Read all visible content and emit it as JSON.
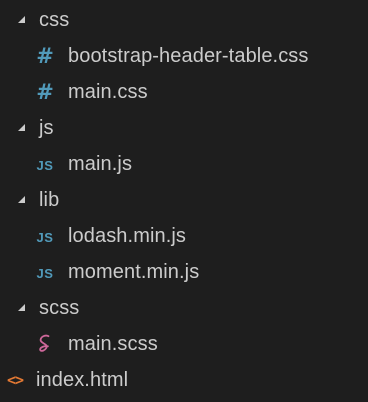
{
  "explorer": {
    "items": [
      {
        "type": "folder",
        "label": "css",
        "icon": "chevron-down-icon"
      },
      {
        "type": "file",
        "label": "bootstrap-header-table.css",
        "icon_glyph": "#",
        "icon": "css-file-icon",
        "color": "#519aba"
      },
      {
        "type": "file",
        "label": "main.css",
        "icon_glyph": "#",
        "icon": "css-file-icon",
        "color": "#519aba"
      },
      {
        "type": "folder",
        "label": "js",
        "icon": "chevron-down-icon"
      },
      {
        "type": "file",
        "label": "main.js",
        "icon_glyph": "JS",
        "icon": "js-file-icon",
        "color": "#519aba"
      },
      {
        "type": "folder",
        "label": "lib",
        "icon": "chevron-down-icon"
      },
      {
        "type": "file",
        "label": "lodash.min.js",
        "icon_glyph": "JS",
        "icon": "js-file-icon",
        "color": "#519aba"
      },
      {
        "type": "file",
        "label": "moment.min.js",
        "icon_glyph": "JS",
        "icon": "js-file-icon",
        "color": "#519aba"
      },
      {
        "type": "folder",
        "label": "scss",
        "icon": "chevron-down-icon"
      },
      {
        "type": "file",
        "label": "main.scss",
        "icon": "sass-file-icon",
        "color": "#cd6799"
      },
      {
        "type": "root-file",
        "label": "index.html",
        "icon_glyph": "<>",
        "icon": "html-file-icon",
        "color": "#e37933"
      }
    ]
  },
  "colors": {
    "background": "#1e1e1e",
    "text": "#cccccc",
    "css_js_icon": "#519aba",
    "sass_icon": "#cd6799",
    "html_icon": "#e37933"
  }
}
